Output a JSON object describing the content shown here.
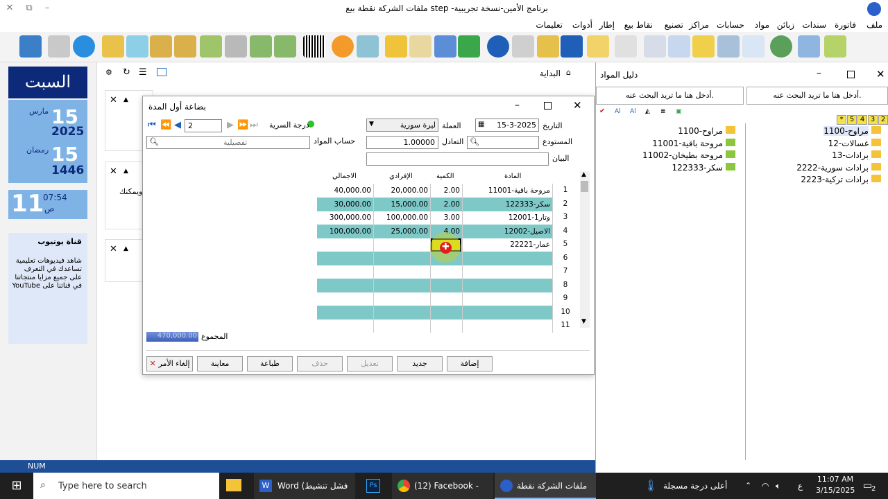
{
  "window": {
    "title": "ملفات الشركة نقطة بيع step -برنامج الأمين-نسخة تجريبية"
  },
  "menu": [
    "ملف",
    "فاتورة",
    "سندات",
    "زبائن",
    "مواد",
    "حسابات",
    "مراكز",
    "تصنيع",
    "نقاط بيع",
    "إطار",
    "أدوات",
    "تعليمات"
  ],
  "left_panel": {
    "day": "السبت",
    "greg_day": "15",
    "greg_month": "مارس",
    "greg_year": "2025",
    "hijri_day": "15",
    "hijri_month": "رمضان",
    "hijri_year": "1446",
    "time": "07:54",
    "ampm": "ص",
    "big_hour": "11",
    "channel_title": "قناة يوتيوب",
    "channel_text": "شاهد فيديوهات تعليمية تساعدك في التعرف على جميع مزايا منتجاتنا في قناتنا على YouTube"
  },
  "main": {
    "breadcrumb": "البداية",
    "card_text": "ويمكنك"
  },
  "dialog": {
    "title": "بضاعة أول المدة",
    "date_label": "التاريخ",
    "date_value": "15-3-2025",
    "currency_label": "العملة",
    "currency_value": "ليرة سورية",
    "secrecy_label": "درجة السرية",
    "page_number": "2",
    "warehouse_label": "المستودع",
    "rate_label": "التعادل",
    "rate_value": "1.00000",
    "account_label": "حساب المواد",
    "account_value": "تفصيلية",
    "statement_label": "البيان",
    "columns": [
      "المادة",
      "الكمية",
      "الإفرادي",
      "الاجمالي"
    ],
    "rows": [
      {
        "n": "1",
        "item": "11001-مروحة باقية",
        "qty": "2.00",
        "unit": "20,000.00",
        "total": "40,000.00"
      },
      {
        "n": "2",
        "item": "122333-سكر",
        "qty": "2.00",
        "unit": "15,000.00",
        "total": "30,000.00"
      },
      {
        "n": "3",
        "item": "12001-وتار1",
        "qty": "3.00",
        "unit": "100,000.00",
        "total": "300,000.00"
      },
      {
        "n": "4",
        "item": "12002-الاصيل",
        "qty": "4.00",
        "unit": "25,000.00",
        "total": "100,000.00"
      },
      {
        "n": "5",
        "item": "22221-عمار",
        "qty": "",
        "unit": "",
        "total": ""
      },
      {
        "n": "6",
        "item": "",
        "qty": "",
        "unit": "",
        "total": ""
      },
      {
        "n": "7",
        "item": "",
        "qty": "",
        "unit": "",
        "total": ""
      },
      {
        "n": "8",
        "item": "",
        "qty": "",
        "unit": "",
        "total": ""
      },
      {
        "n": "9",
        "item": "",
        "qty": "",
        "unit": "",
        "total": ""
      },
      {
        "n": "10",
        "item": "",
        "qty": "",
        "unit": "",
        "total": ""
      },
      {
        "n": "11",
        "item": "",
        "qty": "",
        "unit": "",
        "total": ""
      }
    ],
    "total_label": "المجموع",
    "total_value": "470,000.00",
    "buttons": {
      "add": "إضافة",
      "new": "جديد",
      "edit": "تعديل",
      "delete": "حذف",
      "print": "طباعة",
      "preview": "معاينة",
      "cancel": "إلغاء الأمر"
    }
  },
  "right_panel": {
    "title": "دليل المواد",
    "search_placeholder": "أدخل هنا ما تريد البحث عنه.",
    "level_tabs": [
      "2",
      "3",
      "4",
      "5",
      "*"
    ],
    "tree_left": [
      "1100-مراوح",
      "11001-مروحة باقية",
      "11002-مروحة بطيخان",
      "122333-سكر"
    ],
    "tree_right": [
      "1100-مراوح",
      "12-غسالات",
      "13-برادات",
      "2222-برادات سورية",
      "2223-برادات تركية"
    ]
  },
  "status": {
    "num": "NUM"
  },
  "taskbar": {
    "search": "Type here to search",
    "apps": [
      "Word (فشل تنشيط ا...",
      "(12) Facebook - Go...",
      "ملفات الشركة نقطة ..."
    ],
    "weather": "أعلى درجة مسجلة",
    "lang": "ع",
    "time": "11:07 AM",
    "date": "3/15/2025",
    "notif": "2"
  },
  "colors": {
    "accent_navy": "#0d2a7a",
    "accent_light": "#7fb3e6",
    "row_teal": "#7fc8c8",
    "status_blue": "#1e4f96"
  }
}
